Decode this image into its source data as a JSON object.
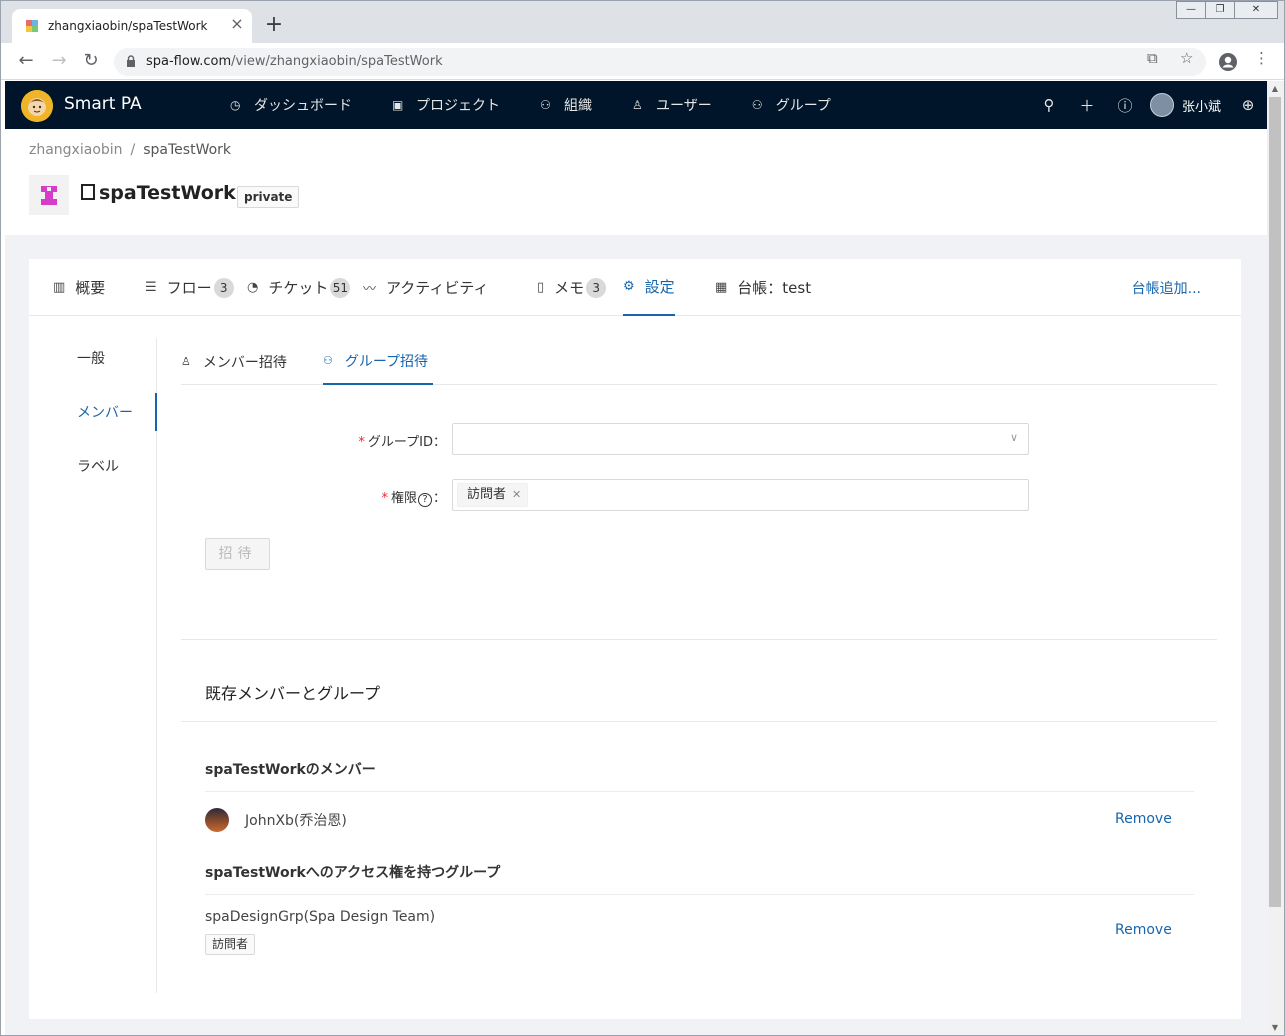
{
  "browser": {
    "tab_title": "zhangxiaobin/spaTestWork",
    "tab_close": "×",
    "new_tab": "+",
    "url_host": "spa-flow.com",
    "url_path": "/view/zhangxiaobin/spaTestWork"
  },
  "appbar": {
    "brand": "Smart PA",
    "nav": [
      {
        "icon": "dashboard-icon",
        "label": "ダッシュボード"
      },
      {
        "icon": "project-icon",
        "label": "プロジェクト"
      },
      {
        "icon": "organization-icon",
        "label": "組織"
      },
      {
        "icon": "user-icon",
        "label": "ユーザー"
      },
      {
        "icon": "group-icon",
        "label": "グループ"
      }
    ],
    "username": "张小斌"
  },
  "project": {
    "breadcrumb_owner": "zhangxiaobin",
    "breadcrumb_sep": "/",
    "breadcrumb_repo": "spaTestWork",
    "title": "spaTestWork",
    "visibility": "private"
  },
  "tabs": [
    {
      "label": "概要",
      "count": ""
    },
    {
      "label": "フロー",
      "count": "3"
    },
    {
      "label": "チケット",
      "count": "51"
    },
    {
      "label": "アクティビティ",
      "count": ""
    },
    {
      "label": "メモ",
      "count": "3"
    },
    {
      "label": "設定",
      "count": ""
    },
    {
      "label": "台帳：test",
      "count": ""
    }
  ],
  "add_ledger": "台帳追加...",
  "side_menu": [
    "一般",
    "メンバー",
    "ラベル"
  ],
  "sub_tabs": [
    "メンバー招待",
    "グループ招待"
  ],
  "form": {
    "group_id_label": "グループID",
    "permission_label": "権限",
    "permission_help": "?",
    "colon": "：",
    "required_mark": "*",
    "permission_value": "訪問者",
    "invite_button": "招待"
  },
  "existing": {
    "title": "既存メンバーとグループ",
    "members_title": "spaTestWorkのメンバー",
    "members": [
      {
        "name": "JohnXb(乔治恩)",
        "action": "Remove"
      }
    ],
    "groups_title": "spaTestWorkへのアクセス権を持つグループ",
    "groups": [
      {
        "name": "spaDesignGrp(Spa Design Team)",
        "role": "訪問者",
        "action": "Remove"
      }
    ]
  },
  "colors": {
    "header_bg": "#001529",
    "accent": "#1765ad",
    "required": "#f5222d"
  }
}
